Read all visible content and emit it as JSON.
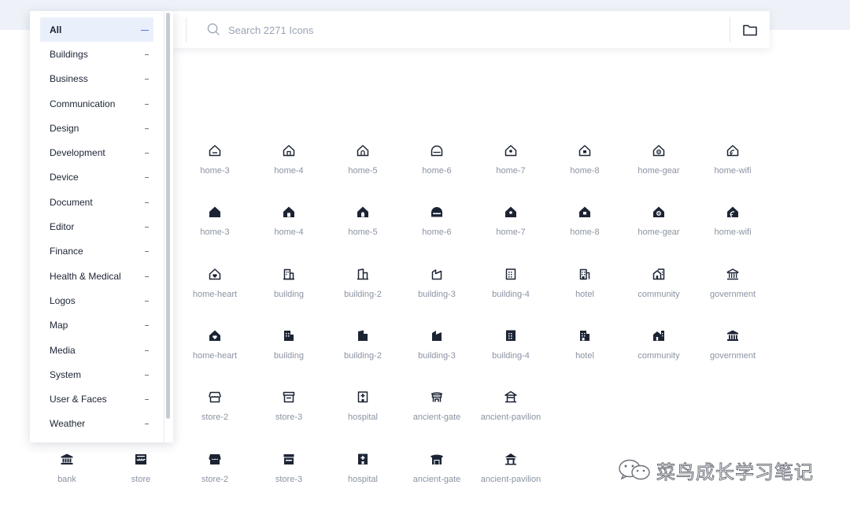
{
  "search": {
    "placeholder": "Search 2271 Icons",
    "value": ""
  },
  "icons_semantic": {
    "search": "search-icon",
    "folder": "folder-icon"
  },
  "colors": {
    "accent": "#4a7ae8",
    "active_bg": "#eaf0fb",
    "icon": "#1c2434",
    "label": "#8b93a3"
  },
  "sidebar": {
    "categories": [
      {
        "label": "All",
        "active": true
      },
      {
        "label": "Buildings"
      },
      {
        "label": "Business"
      },
      {
        "label": "Communication"
      },
      {
        "label": "Design"
      },
      {
        "label": "Development"
      },
      {
        "label": "Device"
      },
      {
        "label": "Document"
      },
      {
        "label": "Editor"
      },
      {
        "label": "Finance"
      },
      {
        "label": "Health & Medical"
      },
      {
        "label": "Logos"
      },
      {
        "label": "Map"
      },
      {
        "label": "Media"
      },
      {
        "label": "System"
      },
      {
        "label": "User & Faces"
      },
      {
        "label": "Weather"
      }
    ]
  },
  "grid": {
    "rows": [
      {
        "style": "line",
        "items": [
          {
            "name": "home-3",
            "icon": "home-3-line-icon"
          },
          {
            "name": "home-4",
            "icon": "home-4-line-icon"
          },
          {
            "name": "home-5",
            "icon": "home-5-line-icon"
          },
          {
            "name": "home-6",
            "icon": "home-6-line-icon"
          },
          {
            "name": "home-7",
            "icon": "home-7-line-icon"
          },
          {
            "name": "home-8",
            "icon": "home-8-line-icon"
          },
          {
            "name": "home-gear",
            "icon": "home-gear-line-icon"
          },
          {
            "name": "home-wifi",
            "icon": "home-wifi-line-icon"
          }
        ]
      },
      {
        "style": "fill",
        "items": [
          {
            "name": "home-3",
            "icon": "home-3-fill-icon"
          },
          {
            "name": "home-4",
            "icon": "home-4-fill-icon"
          },
          {
            "name": "home-5",
            "icon": "home-5-fill-icon"
          },
          {
            "name": "home-6",
            "icon": "home-6-fill-icon"
          },
          {
            "name": "home-7",
            "icon": "home-7-fill-icon"
          },
          {
            "name": "home-8",
            "icon": "home-8-fill-icon"
          },
          {
            "name": "home-gear",
            "icon": "home-gear-fill-icon"
          },
          {
            "name": "home-wifi",
            "icon": "home-wifi-fill-icon"
          }
        ]
      },
      {
        "style": "line",
        "items": [
          {
            "name": "home-heart",
            "icon": "home-heart-line-icon"
          },
          {
            "name": "building",
            "icon": "building-line-icon"
          },
          {
            "name": "building-2",
            "icon": "building-2-line-icon"
          },
          {
            "name": "building-3",
            "icon": "building-3-line-icon"
          },
          {
            "name": "building-4",
            "icon": "building-4-line-icon"
          },
          {
            "name": "hotel",
            "icon": "hotel-line-icon"
          },
          {
            "name": "community",
            "icon": "community-line-icon"
          },
          {
            "name": "government",
            "icon": "government-line-icon"
          }
        ]
      },
      {
        "style": "fill",
        "items": [
          {
            "name": "home-heart",
            "icon": "home-heart-fill-icon"
          },
          {
            "name": "building",
            "icon": "building-fill-icon"
          },
          {
            "name": "building-2",
            "icon": "building-2-fill-icon"
          },
          {
            "name": "building-3",
            "icon": "building-3-fill-icon"
          },
          {
            "name": "building-4",
            "icon": "building-4-fill-icon"
          },
          {
            "name": "hotel",
            "icon": "hotel-fill-icon"
          },
          {
            "name": "community",
            "icon": "community-fill-icon"
          },
          {
            "name": "government",
            "icon": "government-fill-icon"
          }
        ]
      },
      {
        "style": "line",
        "items": [
          {
            "name": "store-2",
            "icon": "store-2-line-icon"
          },
          {
            "name": "store-3",
            "icon": "store-3-line-icon"
          },
          {
            "name": "hospital",
            "icon": "hospital-line-icon"
          },
          {
            "name": "ancient-gate",
            "icon": "ancient-gate-line-icon"
          },
          {
            "name": "ancient-pavilion",
            "icon": "ancient-pavilion-line-icon"
          }
        ]
      },
      {
        "style": "fill",
        "items": [
          {
            "name": "bank",
            "icon": "bank-fill-icon"
          },
          {
            "name": "store",
            "icon": "store-fill-icon"
          },
          {
            "name": "store-2",
            "icon": "store-2-fill-icon"
          },
          {
            "name": "store-3",
            "icon": "store-3-fill-icon"
          },
          {
            "name": "hospital",
            "icon": "hospital-fill-icon"
          },
          {
            "name": "ancient-gate",
            "icon": "ancient-gate-fill-icon"
          },
          {
            "name": "ancient-pavilion",
            "icon": "ancient-pavilion-fill-icon"
          }
        ]
      }
    ]
  },
  "watermark": {
    "text": "菜鸟成长学习笔记",
    "icon": "wechat-icon"
  }
}
